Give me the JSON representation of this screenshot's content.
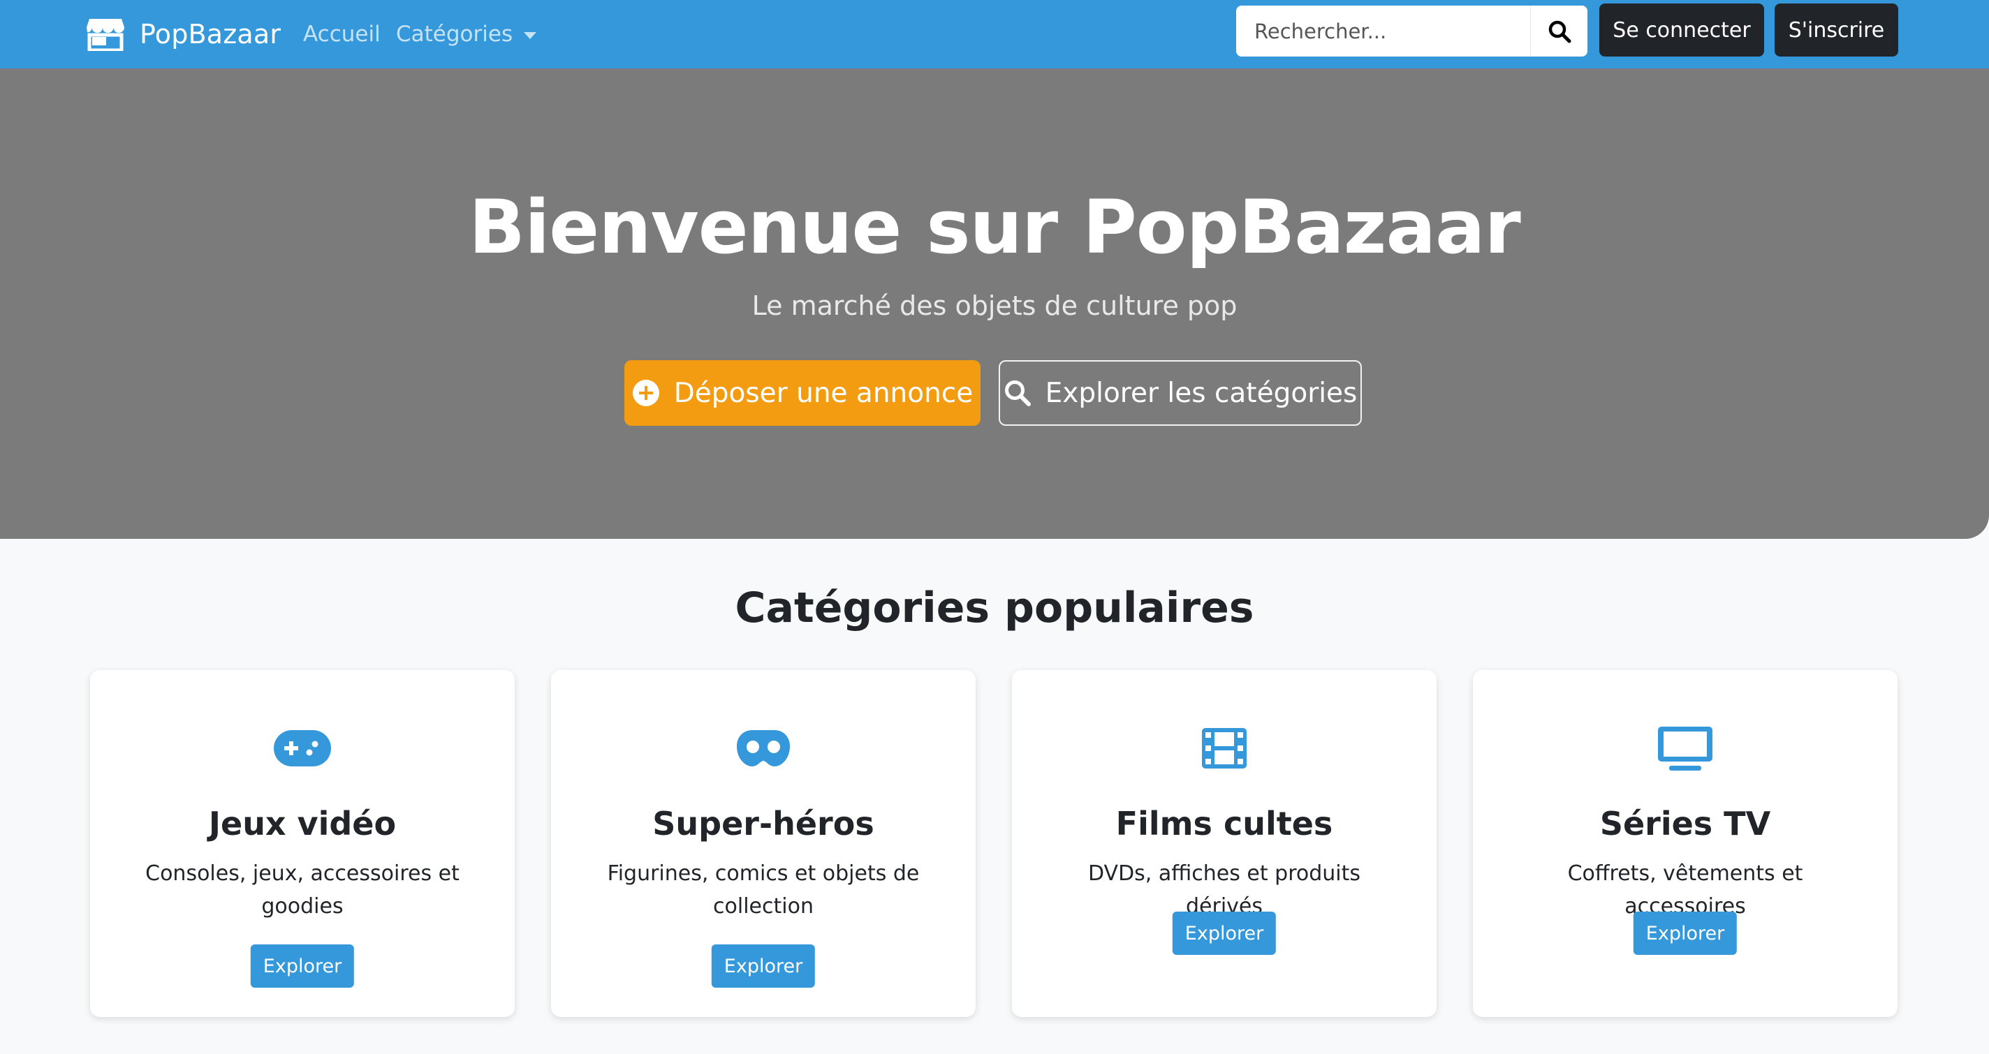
{
  "navbar": {
    "brand": "PopBazaar",
    "brand_icon": "store-icon",
    "links": [
      {
        "label": "Accueil"
      },
      {
        "label": "Catégories"
      }
    ],
    "search": {
      "placeholder": "Rechercher...",
      "value": "",
      "icon": "search-icon"
    },
    "login_label": "Se connecter",
    "signup_label": "S'inscrire"
  },
  "hero": {
    "title": "Bienvenue sur PopBazaar",
    "subtitle": "Le marché des objets de culture pop",
    "post_button": "Déposer une annonce",
    "explore_button": "Explorer les catégories"
  },
  "categories": {
    "title": "Catégories populaires",
    "items": [
      {
        "title": "Jeux vidéo",
        "description": "Consoles, jeux, accessoires et goodies",
        "button": "Explorer",
        "icon": "gamepad-icon"
      },
      {
        "title": "Super-héros",
        "description": "Figurines, comics et objets de collection",
        "button": "Explorer",
        "icon": "mask-icon"
      },
      {
        "title": "Films cultes",
        "description": "DVDs, affiches et produits dérivés",
        "button": "Explorer",
        "icon": "film-icon"
      },
      {
        "title": "Séries TV",
        "description": "Coffrets, vêtements et accessoires",
        "button": "Explorer",
        "icon": "tv-icon"
      }
    ]
  },
  "colors": {
    "primary": "#3498db",
    "accent": "#f39c12",
    "dark": "#212529",
    "hero_bg": "#7b7b7b",
    "page_bg": "#f8f9fa"
  }
}
